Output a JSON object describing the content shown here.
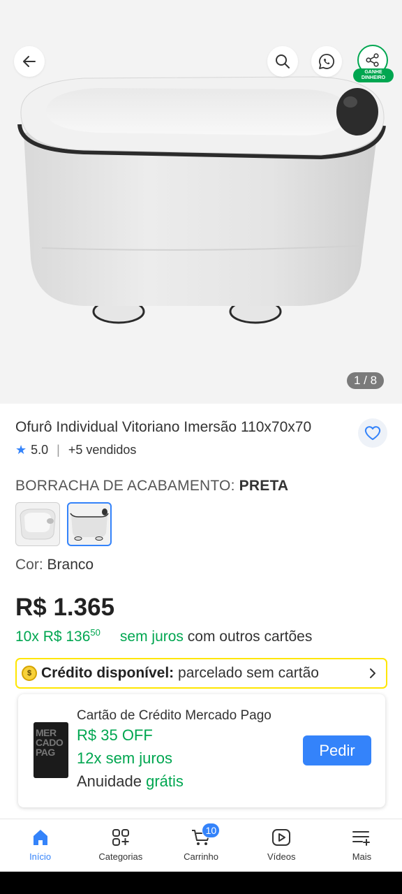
{
  "gallery": {
    "counter": "1 / 8",
    "share_badge": "GANHE DINHEIRO"
  },
  "product": {
    "title": "Ofurô Individual Vitoriano Imersão 110x70x70",
    "rating": "5.0",
    "sold": "+5 vendidos"
  },
  "variant": {
    "label": "BORRACHA DE ACABAMENTO:",
    "value": "PRETA"
  },
  "color": {
    "label": "Cor:",
    "value": "Branco"
  },
  "price": {
    "main": "R$ 1.365",
    "installment_prefix": "10x R$ 136",
    "installment_cents": "50",
    "no_interest": "sem juros",
    "other_cards": "com outros cartões"
  },
  "credit": {
    "coin_symbol": "$",
    "label": "Crédito disponível:",
    "text": "parcelado sem cartão"
  },
  "card_offer": {
    "card_text": [
      "MER",
      "CADO",
      "PAG"
    ],
    "title": "Cartão de Crédito Mercado Pago",
    "discount": "R$ 35 OFF",
    "installments": "12x sem juros",
    "fee_label": "Anuidade",
    "fee_value": "grátis",
    "button": "Pedir"
  },
  "nav": {
    "items": [
      {
        "label": "Início"
      },
      {
        "label": "Categorias"
      },
      {
        "label": "Carrinho"
      },
      {
        "label": "Vídeos"
      },
      {
        "label": "Mais"
      }
    ],
    "cart_count": "10"
  },
  "colors": {
    "accent_blue": "#3483fa",
    "green": "#00a650",
    "yellow": "#ffe600"
  }
}
